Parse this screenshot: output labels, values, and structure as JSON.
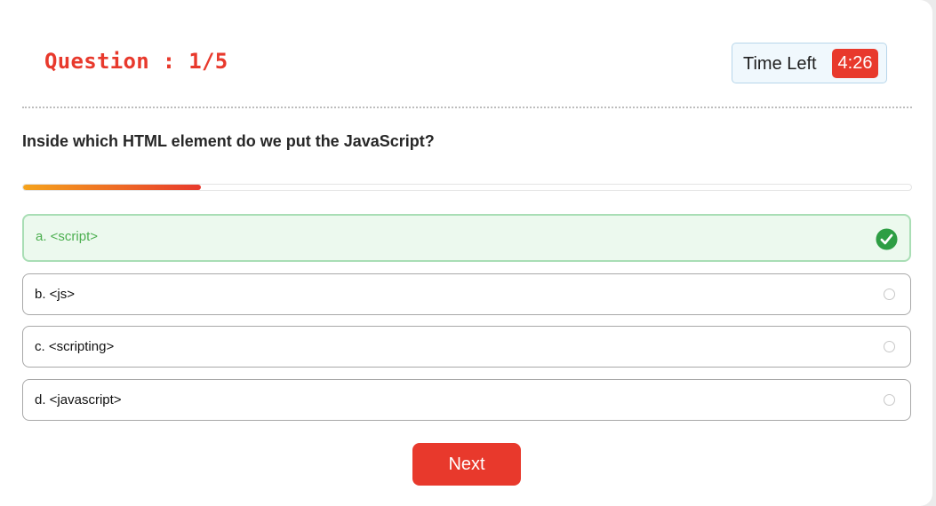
{
  "quiz": {
    "question_counter": "Question : 1/5",
    "timer_label": "Time Left",
    "timer_value": "4:26",
    "question_text": "Inside which HTML element do we put the JavaScript?",
    "progress_fraction": 0.2,
    "options": [
      {
        "label": "a. <script>",
        "state": "correct"
      },
      {
        "label": "b. <js>",
        "state": "unselected"
      },
      {
        "label": "c. <scripting>",
        "state": "unselected"
      },
      {
        "label": "d. <javascript>",
        "state": "unselected"
      }
    ],
    "next_label": "Next"
  },
  "colors": {
    "accent": "#e8392c",
    "progress_start": "#f5a31c",
    "correct_bg": "#ecf9ee",
    "correct_border": "#a9deb5",
    "correct_text": "#4caf50",
    "check_icon": "#2e9e44"
  },
  "icons": {
    "correct_indicator": "check-circle-icon",
    "option_indicator": "radio-circle-icon"
  }
}
